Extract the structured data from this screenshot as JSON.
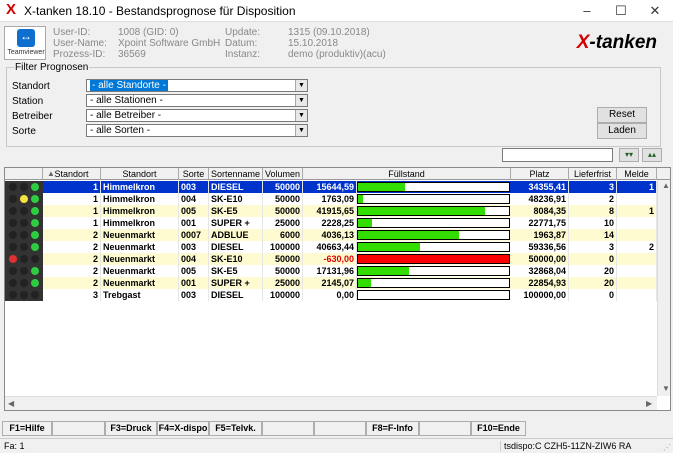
{
  "window": {
    "title": "X-tanken 18.10  -  Bestandsprognose für Disposition",
    "minimize": "–",
    "maximize": "☐",
    "close": "✕"
  },
  "header": {
    "teamviewer_label": "Teamviewer",
    "user_id_label": "User-ID:",
    "user_id": "1008 (GID: 0)",
    "user_name_label": "User-Name:",
    "user_name": "Xpoint Software GmbH",
    "process_id_label": "Prozess-ID:",
    "process_id": "36569",
    "update_label": "Update:",
    "update": "1315 (09.10.2018)",
    "datum_label": "Datum:",
    "datum": "15.10.2018",
    "instanz_label": "Instanz:",
    "instanz": "demo (produktiv)(acu)",
    "brand_x": "X",
    "brand_rest": "-tanken"
  },
  "filter": {
    "legend": "Filter Prognosen",
    "standort_label": "Standort",
    "standort_value": "- alle Standorte -",
    "station_label": "Station",
    "station_value": "- alle Stationen -",
    "betreiber_label": "Betreiber",
    "betreiber_value": "- alle Betreiber -",
    "sorte_label": "Sorte",
    "sorte_value": "- alle Sorten -",
    "reset_label": "Reset",
    "laden_label": "Laden"
  },
  "grid": {
    "headers": [
      "Standort",
      "Standort",
      "Sorte",
      "Sortenname",
      "Volumen",
      "Füllstand",
      "Platz",
      "Lieferfrist",
      "Melde"
    ],
    "rows": [
      {
        "lights": [
          "#222",
          "#222",
          "#2ecc40"
        ],
        "nr": "1",
        "standort": "Himmelkron",
        "sorte": "003",
        "name": "DIESEL",
        "vol": "50000",
        "fill": "15644,59",
        "pct": 0.31,
        "color": "#33dd00",
        "platz": "34355,41",
        "frist": "3",
        "melde": "1",
        "bg": "#0033cc",
        "fg": "#ffffff",
        "negative": false
      },
      {
        "lights": [
          "#222",
          "#f5e342",
          "#2ecc40"
        ],
        "nr": "1",
        "standort": "Himmelkron",
        "sorte": "004",
        "name": "SK-E10",
        "vol": "50000",
        "fill": "1763,09",
        "pct": 0.035,
        "color": "#33dd00",
        "platz": "48236,91",
        "frist": "2",
        "melde": "",
        "bg": "#ffffff",
        "fg": "#000000",
        "negative": false
      },
      {
        "lights": [
          "#222",
          "#222",
          "#2ecc40"
        ],
        "nr": "1",
        "standort": "Himmelkron",
        "sorte": "005",
        "name": "SK-E5",
        "vol": "50000",
        "fill": "41915,65",
        "pct": 0.84,
        "color": "#33dd00",
        "platz": "8084,35",
        "frist": "8",
        "melde": "1",
        "bg": "#fffbd0",
        "fg": "#000000",
        "negative": false
      },
      {
        "lights": [
          "#222",
          "#222",
          "#2ecc40"
        ],
        "nr": "1",
        "standort": "Himmelkron",
        "sorte": "001",
        "name": "SUPER +",
        "vol": "25000",
        "fill": "2228,25",
        "pct": 0.09,
        "color": "#33dd00",
        "platz": "22771,75",
        "frist": "10",
        "melde": "",
        "bg": "#ffffff",
        "fg": "#000000",
        "negative": false
      },
      {
        "lights": [
          "#222",
          "#222",
          "#2ecc40"
        ],
        "nr": "2",
        "standort": "Neuenmarkt",
        "sorte": "0007",
        "name": "ADBLUE",
        "vol": "6000",
        "fill": "4036,13",
        "pct": 0.67,
        "color": "#33dd00",
        "platz": "1963,87",
        "frist": "14",
        "melde": "",
        "bg": "#fffbd0",
        "fg": "#000000",
        "negative": false
      },
      {
        "lights": [
          "#222",
          "#222",
          "#2ecc40"
        ],
        "nr": "2",
        "standort": "Neuenmarkt",
        "sorte": "003",
        "name": "DIESEL",
        "vol": "100000",
        "fill": "40663,44",
        "pct": 0.41,
        "color": "#33dd00",
        "platz": "59336,56",
        "frist": "3",
        "melde": "2",
        "bg": "#ffffff",
        "fg": "#000000",
        "negative": false
      },
      {
        "lights": [
          "#e03030",
          "#222",
          "#222"
        ],
        "nr": "2",
        "standort": "Neuenmarkt",
        "sorte": "004",
        "name": "SK-E10",
        "vol": "50000",
        "fill": "-630,00",
        "pct": 1.0,
        "color": "#ff0000",
        "platz": "50000,00",
        "frist": "0",
        "melde": "",
        "bg": "#fffbd0",
        "fg": "#000000",
        "negative": true
      },
      {
        "lights": [
          "#222",
          "#222",
          "#2ecc40"
        ],
        "nr": "2",
        "standort": "Neuenmarkt",
        "sorte": "005",
        "name": "SK-E5",
        "vol": "50000",
        "fill": "17131,96",
        "pct": 0.34,
        "color": "#33dd00",
        "platz": "32868,04",
        "frist": "20",
        "melde": "",
        "bg": "#ffffff",
        "fg": "#000000",
        "negative": false
      },
      {
        "lights": [
          "#222",
          "#222",
          "#2ecc40"
        ],
        "nr": "2",
        "standort": "Neuenmarkt",
        "sorte": "001",
        "name": "SUPER +",
        "vol": "25000",
        "fill": "2145,07",
        "pct": 0.085,
        "color": "#33dd00",
        "platz": "22854,93",
        "frist": "20",
        "melde": "",
        "bg": "#fffbd0",
        "fg": "#000000",
        "negative": false
      },
      {
        "lights": [
          "#222",
          "#222",
          "#222"
        ],
        "nr": "3",
        "standort": "Trebgast",
        "sorte": "003",
        "name": "DIESEL",
        "vol": "100000",
        "fill": "0,00",
        "pct": 0.0,
        "color": "#33dd00",
        "platz": "100000,00",
        "frist": "0",
        "melde": "",
        "bg": "#ffffff",
        "fg": "#000000",
        "negative": false
      }
    ]
  },
  "fkeys": {
    "f1": "F1=Hilfe",
    "f3": "F3=Druck",
    "f4": "F4=X-dispo",
    "f5": "F5=Telvk.",
    "f8": "F8=F-Info",
    "f10": "F10=Ende"
  },
  "statusbar": {
    "left": "Fa: 1",
    "right": "tsdispo:C CZH5-11ZN-ZIW6 RA"
  }
}
